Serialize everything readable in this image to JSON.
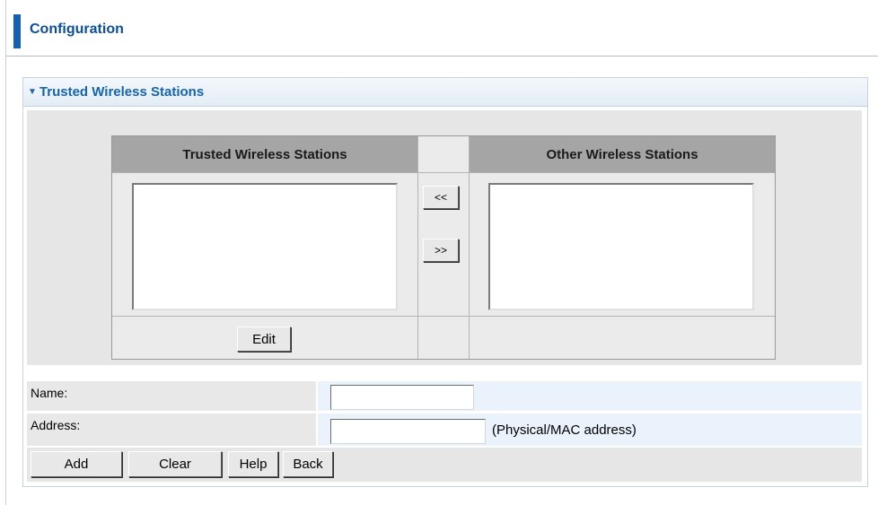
{
  "header": {
    "title": "Configuration"
  },
  "panel": {
    "title": "Trusted Wireless Stations",
    "trusted_header": "Trusted Wireless Stations",
    "other_header": "Other Wireless Stations",
    "move_left_label": "<<",
    "move_right_label": ">>",
    "edit_label": "Edit"
  },
  "form": {
    "name_label": "Name:",
    "name_value": "",
    "address_label": "Address:",
    "address_value": "",
    "address_hint": "(Physical/MAC address)"
  },
  "actions": {
    "add_label": "Add",
    "clear_label": "Clear",
    "help_label": "Help",
    "back_label": "Back"
  },
  "colors": {
    "accent": "#1560b5",
    "title_text": "#0d4f9e",
    "column_header": "#a5a5a5",
    "value_cell": "#eaf2fb"
  }
}
